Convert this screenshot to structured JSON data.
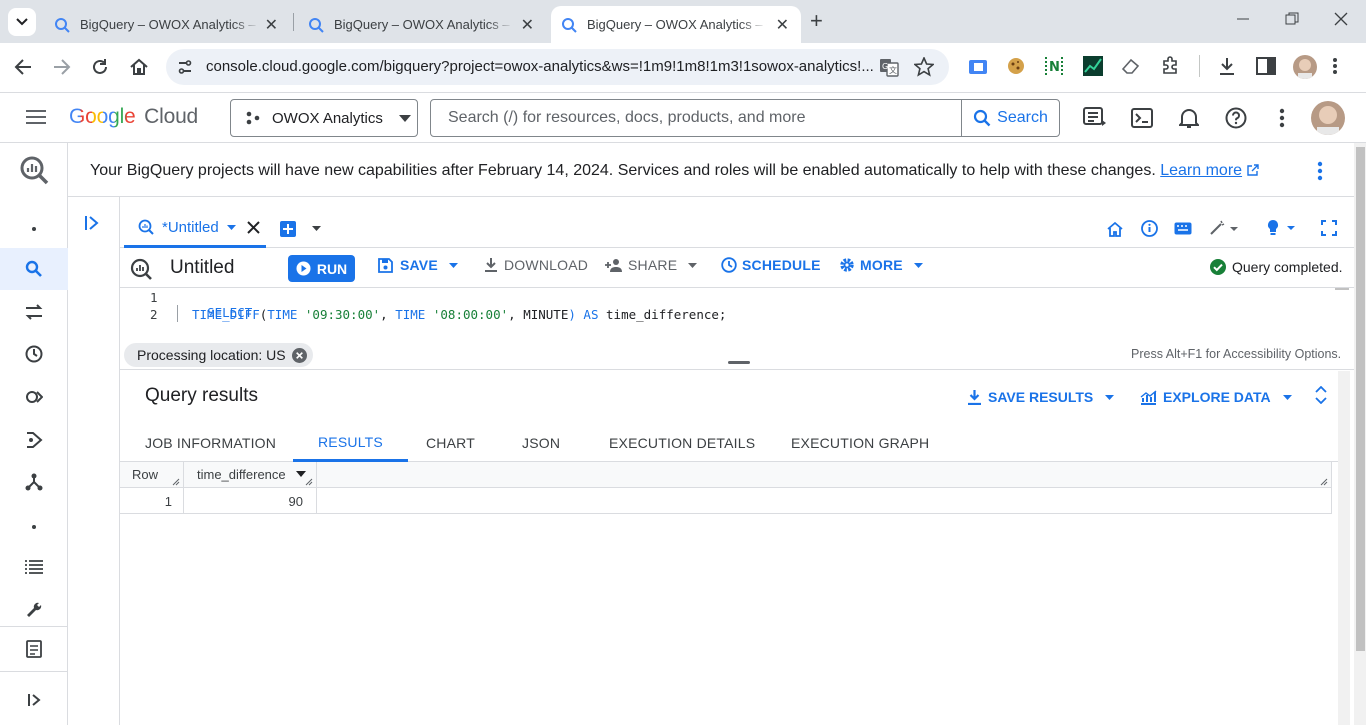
{
  "browser": {
    "tabs": [
      {
        "title": "BigQuery – OWOX Analytics – G"
      },
      {
        "title": "BigQuery – OWOX Analytics – G"
      },
      {
        "title": "BigQuery – OWOX Analytics – G"
      }
    ],
    "new_tab": "+",
    "url": "console.cloud.google.com/bigquery?project=owox-analytics&ws=!1m9!1m8!1m3!1sowox-analytics!..."
  },
  "header": {
    "logo_google": "Google",
    "logo_cloud": "Cloud",
    "project": "OWOX Analytics",
    "search_placeholder": "Search (/) for resources, docs, products, and more",
    "search_button": "Search"
  },
  "banner": {
    "text": "Your BigQuery projects will have new capabilities after February 14, 2024. Services and roles will be enabled automatically to help with these changes.",
    "link": "Learn more"
  },
  "editor": {
    "tab_label": "*Untitled",
    "title": "Untitled",
    "run": "RUN",
    "save": "SAVE",
    "download": "DOWNLOAD",
    "share": "SHARE",
    "schedule": "SCHEDULE",
    "more": "MORE",
    "status": "Query completed.",
    "lines": [
      {
        "num": "1",
        "code": "SELECT"
      },
      {
        "num": "2",
        "code": "TIME_DIFF(TIME '09:30:00', TIME '08:00:00', MINUTE) AS time_difference;"
      }
    ],
    "tokens": {
      "select": "SELECT",
      "fn": "TIME_DIFF",
      "p1": "(",
      "time1": "TIME",
      "str1": "'09:30:00'",
      "comma1": ", ",
      "time2": "TIME",
      "str2": "'08:00:00'",
      "comma2": ", ",
      "minute": "MINUTE",
      "p2": ")",
      "as": "AS",
      "alias": "time_difference;"
    },
    "location": "Processing location: US",
    "accessibility": "Press Alt+F1 for Accessibility Options."
  },
  "results": {
    "title": "Query results",
    "save_results": "SAVE RESULTS",
    "explore_data": "EXPLORE DATA",
    "tabs": [
      "JOB INFORMATION",
      "RESULTS",
      "CHART",
      "JSON",
      "EXECUTION DETAILS",
      "EXECUTION GRAPH"
    ],
    "columns": [
      "Row",
      "time_difference"
    ],
    "rows": [
      [
        "1",
        "90"
      ]
    ]
  },
  "colors": {
    "accent": "#1a73e8",
    "success": "#188038"
  }
}
